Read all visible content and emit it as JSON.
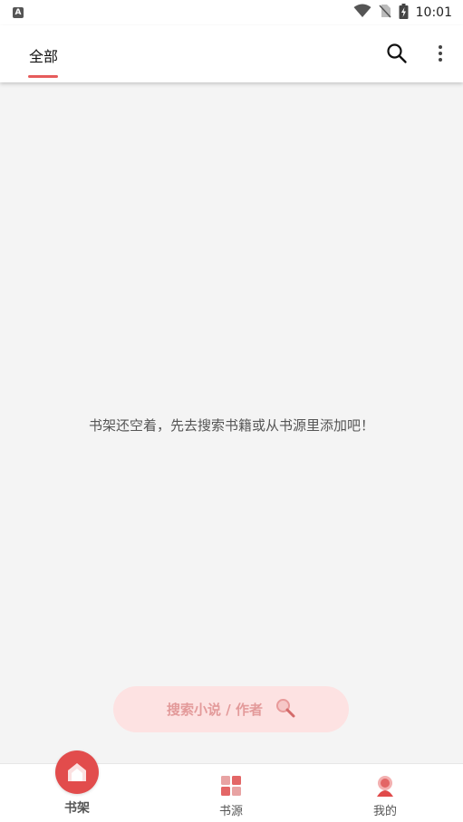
{
  "status_bar": {
    "notification_badge": "A",
    "time": "10:01",
    "icons": [
      "wifi-icon",
      "no-sim-icon",
      "battery-charging-icon"
    ]
  },
  "top_bar": {
    "tab_label": "全部",
    "actions": [
      "search-icon",
      "more-vert-icon"
    ]
  },
  "empty_state": {
    "message": "书架还空着，先去搜索书籍或从书源里添加吧！"
  },
  "search_button": {
    "label": "搜索小说 / 作者",
    "icon": "magnifier-icon"
  },
  "bottom_nav": {
    "items": [
      {
        "label": "书架",
        "icon": "bookshelf-icon",
        "active": true
      },
      {
        "label": "书源",
        "icon": "book-source-icon",
        "active": false
      },
      {
        "label": "我的",
        "icon": "profile-icon",
        "active": false
      }
    ]
  },
  "colors": {
    "accent": "#e24c4c",
    "pill_bg": "#fde2e2",
    "pill_text": "#e39a9a",
    "background": "#f4f4f4"
  }
}
